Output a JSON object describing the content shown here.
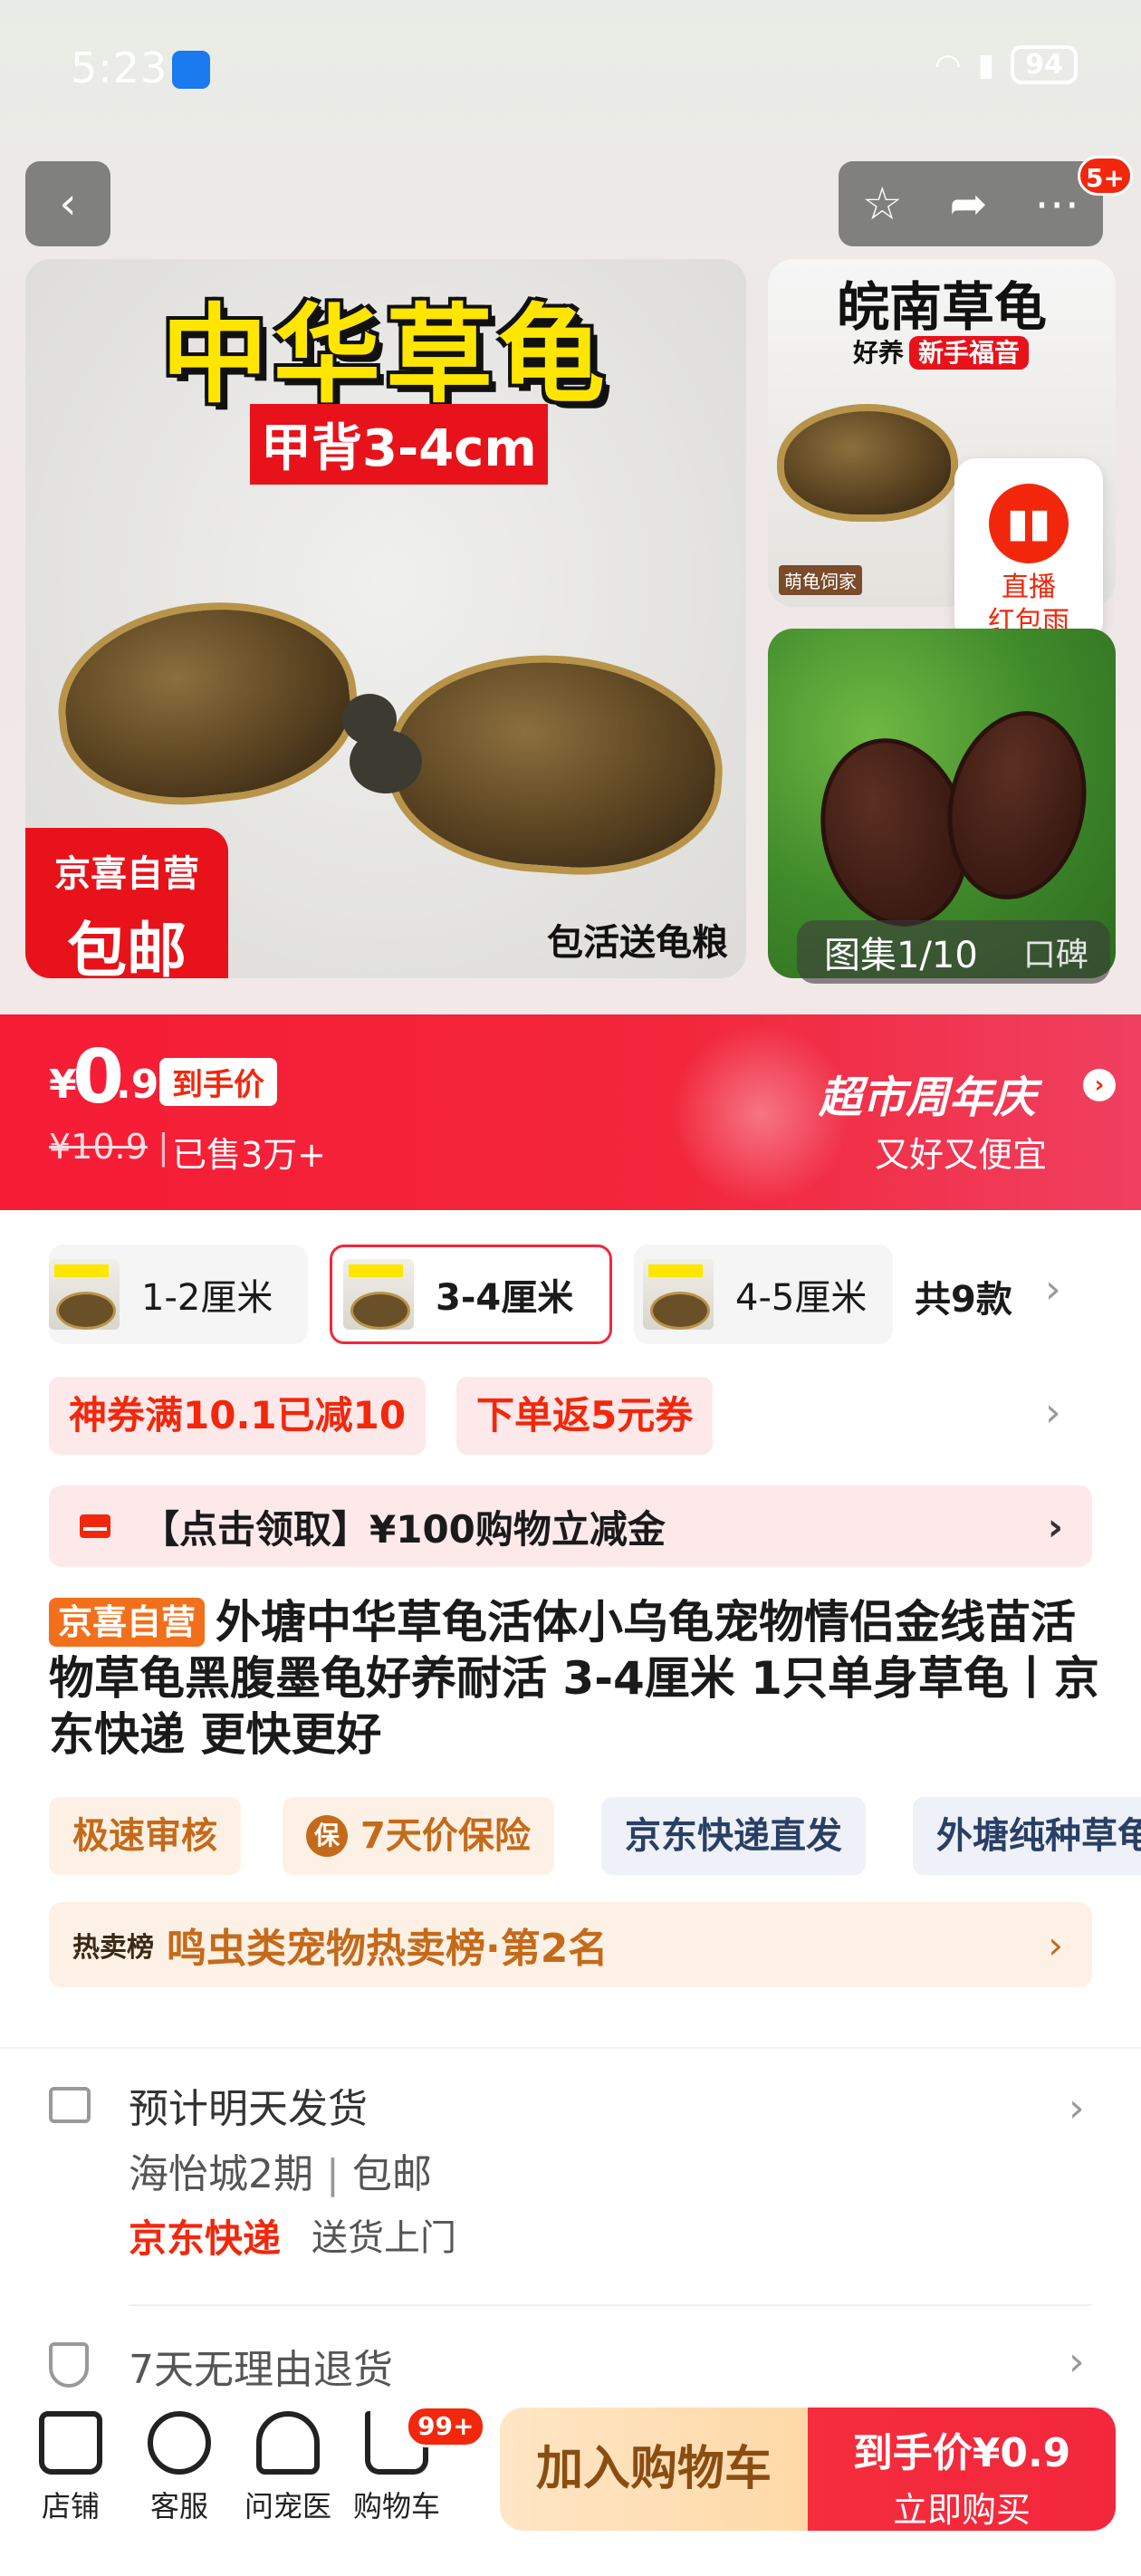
{
  "status_bar": {
    "time": "5:23",
    "network": "6",
    "battery": "94"
  },
  "nav": {
    "back_icon": "chevron-left-icon",
    "badge": "5+"
  },
  "gallery": {
    "main_title": "中华草龟",
    "main_subtitle": "甲背3-4cm",
    "main_badge_line1": "京喜自营",
    "main_badge_line2": "包邮",
    "main_caption": "包活送龟粮",
    "thumb1_title": "皖南草龟",
    "thumb1_sub": "好养",
    "thumb1_sub_tag": "新手福音",
    "thumb1_store": "萌龟饲家",
    "live_line1": "直播",
    "live_line2": "红包雨",
    "album": "图集1/10",
    "reviews": "口碑"
  },
  "price": {
    "yen": "¥",
    "int": "0",
    "dec": ".9",
    "tag": "到手价",
    "original": "¥10.9",
    "sep": "|",
    "sold": "已售3万+",
    "promo_title": "超市周年庆",
    "promo_sub": "又好又便宜"
  },
  "specs": {
    "items": [
      "1-2厘米",
      "3-4厘米",
      "4-5厘米"
    ],
    "selected": 1,
    "count": "共9款"
  },
  "coupons": [
    "神券满10.1已减10",
    "下单返5元券"
  ],
  "voucher": "【点击领取】¥100购物立减金",
  "product": {
    "badge": "京喜自营",
    "title": "外塘中华草龟活体小乌龟宠物情侣金线苗活物草龟黑腹墨龟好养耐活 3-4厘米 1只单身草龟丨京东快递 更快更好"
  },
  "features": [
    "极速审核",
    "7天价保险",
    "京东快递直发",
    "外塘纯种草龟"
  ],
  "feature_shield": "保",
  "rank": {
    "label": "热卖榜",
    "text": "鸣虫类宠物热卖榜·第2名"
  },
  "delivery": {
    "ship": "预计明天发货",
    "address": "海怡城2期",
    "address_sep": "|",
    "shipping": "包邮",
    "express": "京东快递",
    "door": "送货上门",
    "return_policy": "7天无理由退货"
  },
  "bottom": {
    "store": "店铺",
    "service": "客服",
    "vet": "问宠医",
    "cart": "购物车",
    "cart_badge": "99+",
    "add_cart": "加入购物车",
    "buy_price": "到手价¥0.9",
    "buy_action": "立即购买"
  },
  "colors": {
    "accent": "#f2270c",
    "promo_bg": "#f61c35",
    "gold": "#c56a1a"
  }
}
